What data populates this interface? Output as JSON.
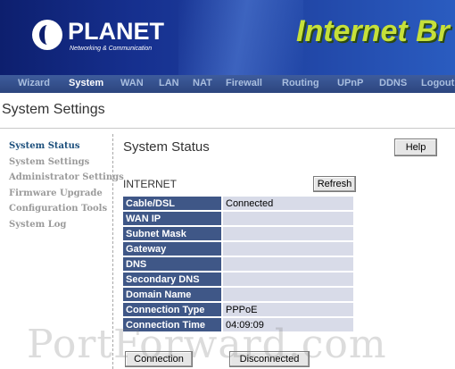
{
  "header": {
    "brand": "PLANET",
    "brand_tagline": "Networking & Communication",
    "banner_title": "Internet Br"
  },
  "nav": {
    "items": [
      {
        "label": "Wizard",
        "active": false
      },
      {
        "label": "System",
        "active": true
      },
      {
        "label": "WAN",
        "active": false
      },
      {
        "label": "LAN",
        "active": false
      },
      {
        "label": "NAT",
        "active": false
      },
      {
        "label": "Firewall",
        "active": false
      },
      {
        "label": "Routing",
        "active": false
      },
      {
        "label": "UPnP",
        "active": false
      },
      {
        "label": "DDNS",
        "active": false
      },
      {
        "label": "Logout",
        "active": false
      }
    ]
  },
  "page": {
    "title": "System Settings"
  },
  "sidebar": {
    "items": [
      {
        "label": "System Status",
        "active": true
      },
      {
        "label": "System Settings",
        "active": false
      },
      {
        "label": "Administrator Settings",
        "active": false
      },
      {
        "label": "Firmware Upgrade",
        "active": false
      },
      {
        "label": "Configuration Tools",
        "active": false
      },
      {
        "label": "System Log",
        "active": false
      }
    ]
  },
  "main": {
    "section_title": "System Status",
    "help_label": "Help",
    "internet_label": "INTERNET",
    "refresh_label": "Refresh",
    "status_rows": [
      {
        "label": "Cable/DSL",
        "value": "Connected"
      },
      {
        "label": "WAN IP",
        "value": ""
      },
      {
        "label": "Subnet Mask",
        "value": ""
      },
      {
        "label": "Gateway",
        "value": ""
      },
      {
        "label": "DNS",
        "value": ""
      },
      {
        "label": "Secondary DNS",
        "value": ""
      },
      {
        "label": "Domain Name",
        "value": ""
      },
      {
        "label": "Connection Type",
        "value": "PPPoE"
      },
      {
        "label": "Connection Time",
        "value": "04:09:09"
      }
    ],
    "connect_label": "Connection",
    "disconnect_label": "Disconnected"
  },
  "watermark": "PortForward.com",
  "colors": {
    "banner_dark": "#0d1f6e",
    "banner_title": "#c6e03a",
    "table_label_bg": "#3f5787",
    "table_value_bg": "#d8dbe8",
    "sidebar_active": "#1c4f7c"
  }
}
